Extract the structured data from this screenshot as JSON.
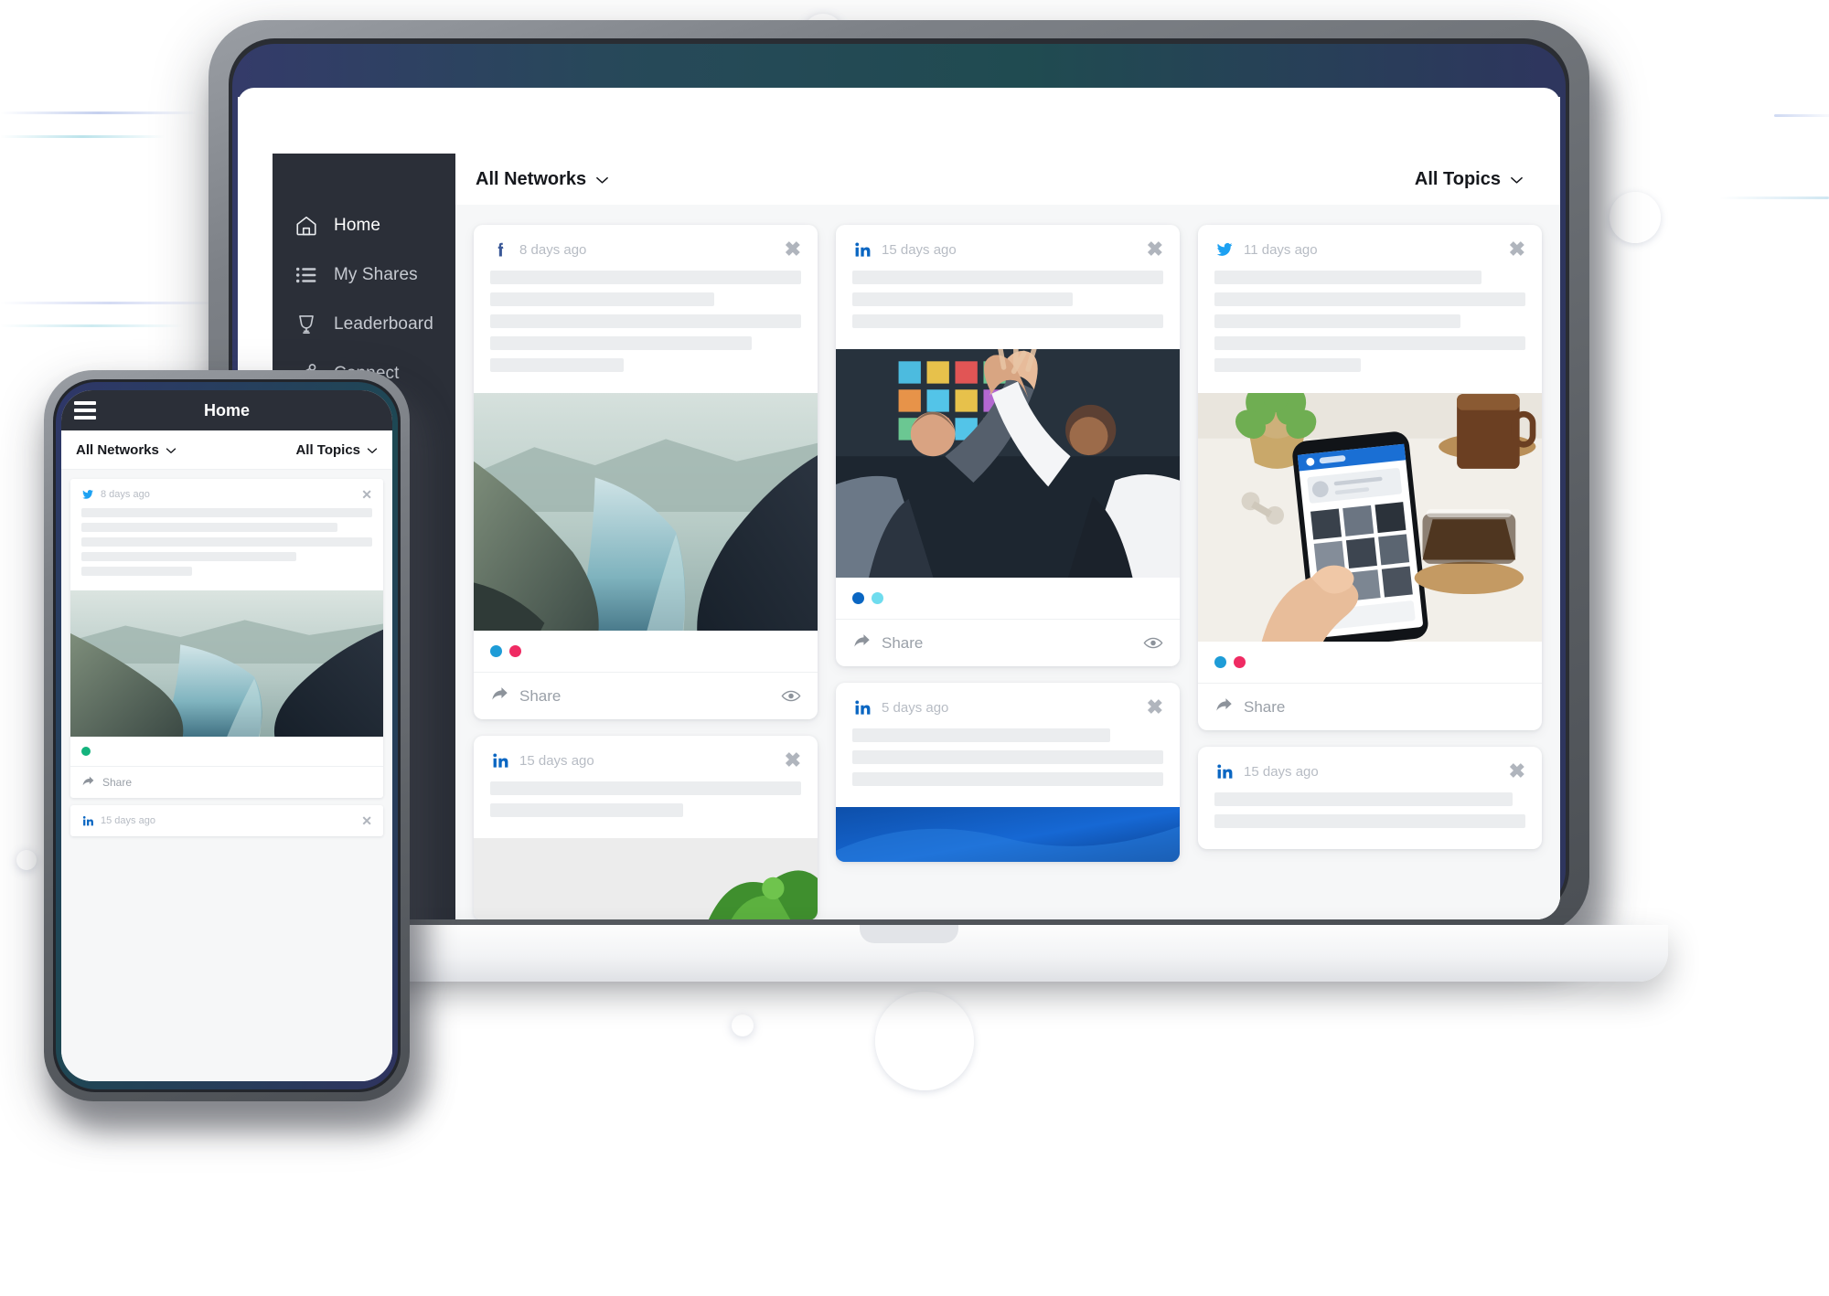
{
  "brand": {
    "sidebar_bg": "#2b2f38",
    "feed_bg": "#f6f7f8",
    "facebook_color": "#3b5998",
    "linkedin_color": "#0a66c2",
    "twitter_color": "#1da1f2"
  },
  "desktop": {
    "sidebar": {
      "items": [
        {
          "label": "Home",
          "icon": "home-icon",
          "active": true
        },
        {
          "label": "My Shares",
          "icon": "list-icon",
          "active": false
        },
        {
          "label": "Leaderboard",
          "icon": "trophy-icon",
          "active": false
        },
        {
          "label": "Connect",
          "icon": "share-network-icon",
          "active": false
        }
      ]
    },
    "topbar": {
      "networks_filter": "All Networks",
      "topics_filter": "All Topics",
      "chevron": "⌄"
    },
    "share_label": "Share",
    "close_glyph": "✖",
    "columns": [
      {
        "cards": [
          {
            "network": "facebook",
            "network_icon": "facebook-icon",
            "time": "8 days ago",
            "skeleton_widths": [
              100,
              72,
              100,
              84,
              43
            ],
            "image": "fjord-landscape",
            "dots": [
              "#1e9cd7",
              "#ef2b63"
            ],
            "has_footer": true,
            "has_eye": true
          },
          {
            "network": "linkedin",
            "network_icon": "linkedin-icon",
            "time": "15 days ago",
            "skeleton_widths": [
              100,
              62
            ],
            "image": "green-foliage",
            "dots": [],
            "has_footer": false,
            "has_eye": false
          }
        ]
      },
      {
        "cards": [
          {
            "network": "linkedin",
            "network_icon": "linkedin-icon",
            "time": "15 days ago",
            "skeleton_widths": [
              100,
              71,
              100
            ],
            "image": "team-high-five",
            "dots": [
              "#0a66c2",
              "#6fdcee"
            ],
            "has_footer": true,
            "has_eye": true
          },
          {
            "network": "linkedin",
            "network_icon": "linkedin-icon",
            "time": "5 days ago",
            "skeleton_widths": [
              83,
              100,
              100
            ],
            "image": "blue-abstract",
            "dots": [],
            "has_footer": false,
            "has_eye": false
          }
        ]
      },
      {
        "cards": [
          {
            "network": "twitter",
            "network_icon": "twitter-icon",
            "time": "11 days ago",
            "skeleton_widths": [
              86,
              100,
              79,
              100,
              47
            ],
            "image": "phone-desk-flatlay",
            "dots": [
              "#1e9cd7",
              "#ef2b63"
            ],
            "has_footer": true,
            "has_eye": false
          },
          {
            "network": "linkedin",
            "network_icon": "linkedin-icon",
            "time": "15 days ago",
            "skeleton_widths": [
              96,
              100
            ],
            "image": "",
            "dots": [],
            "has_footer": false,
            "has_eye": false
          }
        ]
      }
    ]
  },
  "mobile": {
    "header": {
      "title": "Home",
      "menu_icon": "hamburger-icon"
    },
    "filters": {
      "networks_filter": "All Networks",
      "topics_filter": "All Topics",
      "chevron": "⌄"
    },
    "share_label": "Share",
    "close_glyph": "✕",
    "cards": [
      {
        "network": "twitter",
        "network_icon": "twitter-icon",
        "time": "8 days ago",
        "skeleton_widths": [
          100,
          88,
          100,
          74,
          38
        ],
        "image": "fjord-landscape",
        "dots": [
          "#14b37d"
        ],
        "has_footer": true
      },
      {
        "network": "linkedin",
        "network_icon": "linkedin-icon",
        "time": "15 days ago",
        "skeleton_widths": [],
        "image": "",
        "dots": [],
        "has_footer": false
      }
    ]
  }
}
